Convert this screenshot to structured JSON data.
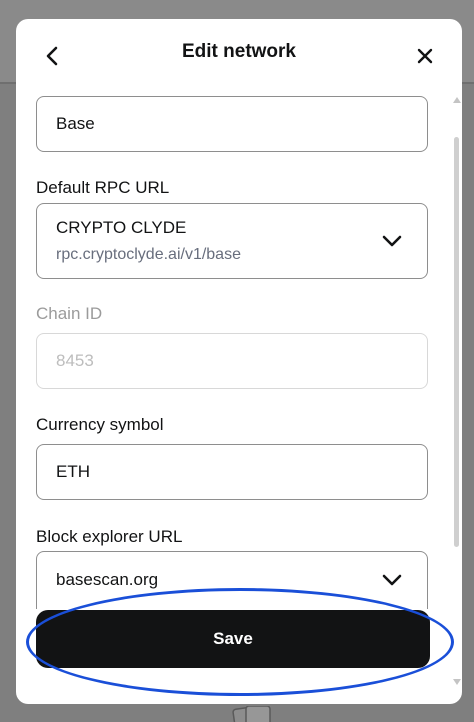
{
  "modal": {
    "title": "Edit network",
    "save_label": "Save"
  },
  "fields": {
    "network_name": {
      "value": "Base"
    },
    "rpc": {
      "label": "Default RPC URL",
      "selected_name": "CRYPTO CLYDE",
      "selected_url": "rpc.cryptoclyde.ai/v1/base"
    },
    "chain_id": {
      "label": "Chain ID",
      "value": "8453"
    },
    "currency": {
      "label": "Currency symbol",
      "value": "ETH"
    },
    "explorer": {
      "label": "Block explorer URL",
      "value": "basescan.org"
    }
  },
  "icons": {
    "back": "chevron-left-icon",
    "close": "close-icon",
    "dropdown": "chevron-down-icon"
  },
  "colors": {
    "button_bg": "#121314",
    "highlight": "#1a4fd8"
  }
}
